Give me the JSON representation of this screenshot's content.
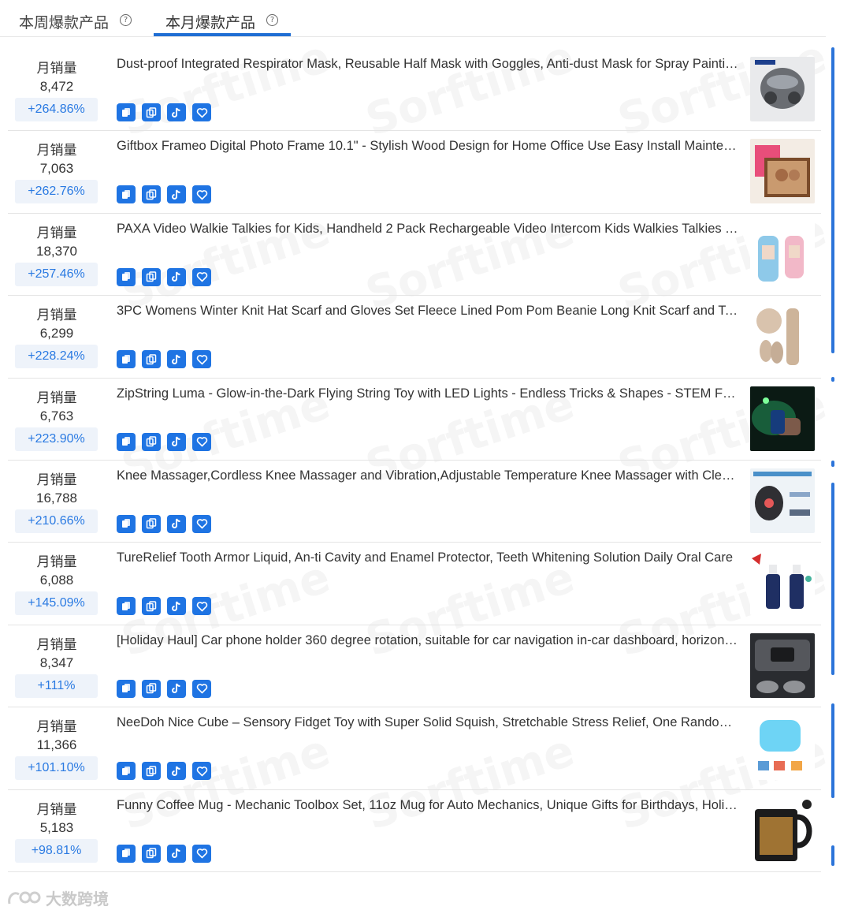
{
  "tabs": [
    {
      "label": "本周爆款产品",
      "help": "?"
    },
    {
      "label": "本月爆款产品",
      "help": "?"
    }
  ],
  "watermark": "Sorftime",
  "footer_logo": "大数跨境",
  "sales_label": "月销量",
  "products": [
    {
      "sales": "8,472",
      "growth": "+264.86%",
      "title": "Dust-proof Integrated Respirator Mask, Reusable Half Mask with Goggles, Anti-dust Mask for Spray Painting Sanding"
    },
    {
      "sales": "7,063",
      "growth": "+262.76%",
      "title": "Giftbox Frameo Digital Photo Frame 10.1\" - Stylish Wood Design for Home Office Use Easy Install Maintenance Free"
    },
    {
      "sales": "18,370",
      "growth": "+257.46%",
      "title": "PAXA Video Walkie Talkies for Kids, Handheld 2 Pack Rechargeable Video Intercom Kids Walkies Talkies Toys"
    },
    {
      "sales": "6,299",
      "growth": "+228.24%",
      "title": "3PC Womens Winter Knit Hat Scarf and Gloves Set Fleece Lined Pom Pom Beanie Long Knit Scarf and Touchscreen Gloves"
    },
    {
      "sales": "6,763",
      "growth": "+223.90%",
      "title": "ZipString Luma - Glow-in-the-Dark Flying String Toy with LED Lights - Endless Tricks & Shapes - STEM Fun for Kids"
    },
    {
      "sales": "16,788",
      "growth": "+210.66%",
      "title": "Knee Massager,Cordless Knee Massager and Vibration,Adjustable Temperature Knee Massager with Clear Display"
    },
    {
      "sales": "6,088",
      "growth": "+145.09%",
      "title": "TureRelief Tooth Armor Liquid, An-ti Cavity and Enamel Protector, Teeth Whitening Solution Daily Oral Care"
    },
    {
      "sales": "8,347",
      "growth": "+111%",
      "title": "[Holiday Haul] Car phone holder 360 degree rotation, suitable for car navigation in-car dashboard, horizontal and vertical"
    },
    {
      "sales": "11,366",
      "growth": "+101.10%",
      "title": "NeeDoh Nice Cube – Sensory Fidget Toy with Super Solid Squish, Stretchable Stress Relief, One Random Color"
    },
    {
      "sales": "5,183",
      "growth": "+98.81%",
      "title": "Funny Coffee Mug - Mechanic Toolbox Set, 11oz Mug for Auto Mechanics, Unique Gifts for Birthdays, Holidays"
    }
  ],
  "colors": {
    "accent": "#1f74e3",
    "growth_text": "#2a7ae2",
    "growth_bg": "#eef3fa"
  },
  "icons": [
    "copy-icon",
    "duplicate-icon",
    "tiktok-icon",
    "heart-icon"
  ]
}
